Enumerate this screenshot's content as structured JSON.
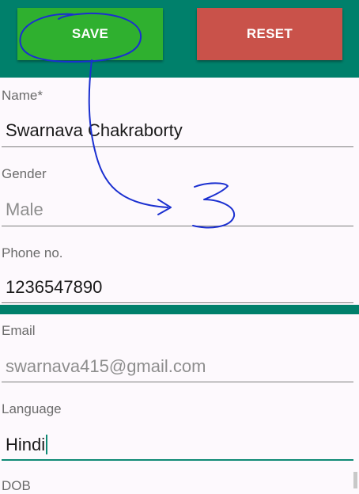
{
  "toolbar": {
    "save_label": "SAVE",
    "reset_label": "RESET"
  },
  "form": {
    "name": {
      "label": "Name*",
      "value": "Swarnava Chakraborty"
    },
    "gender": {
      "label": "Gender",
      "hint": "Male"
    },
    "phone": {
      "label": "Phone no.",
      "value": "1236547890"
    },
    "email": {
      "label": "Email",
      "hint": "swarnava415@gmail.com"
    },
    "language": {
      "label": "Language",
      "value": "Hindi"
    },
    "dob": {
      "label": "DOB"
    }
  },
  "annotation": {
    "text": "3",
    "color": "#1a2fd0"
  },
  "colors": {
    "toolbar_bg": "#00806b",
    "save_bg": "#2fb02f",
    "reset_bg": "#c9524a",
    "accent": "#0f8a75"
  }
}
